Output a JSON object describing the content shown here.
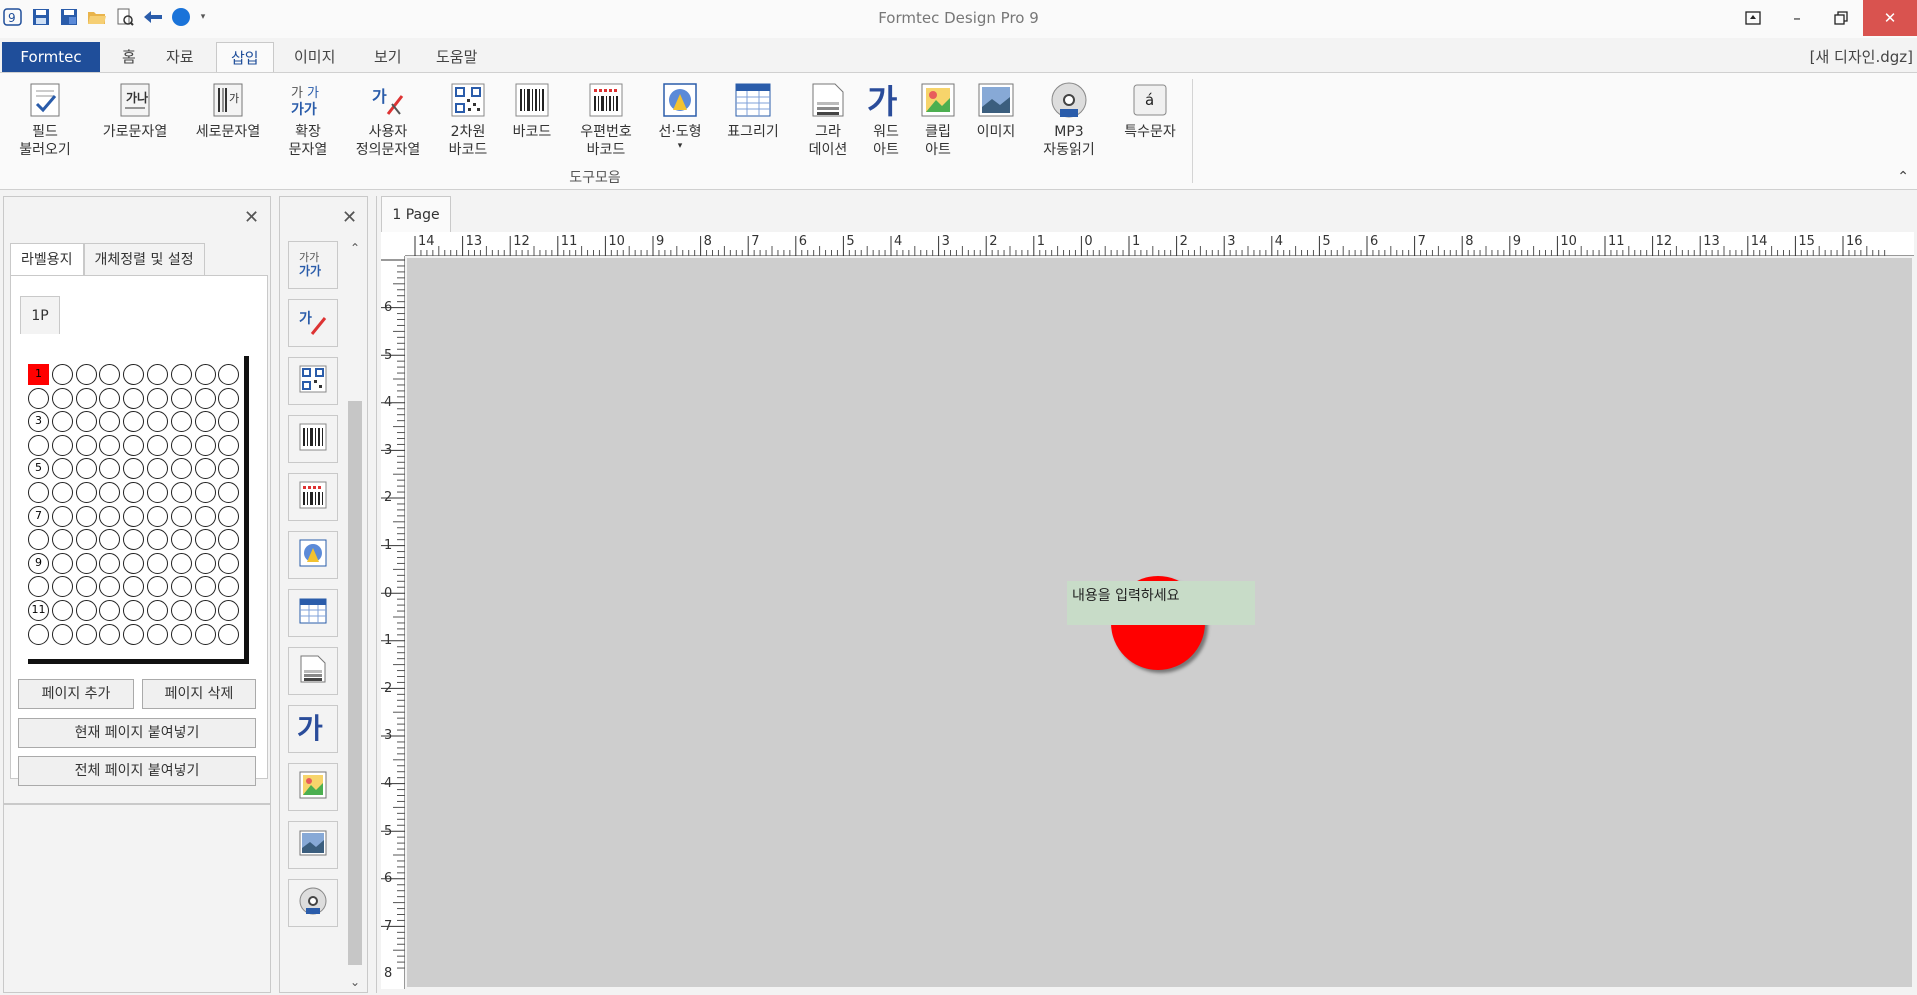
{
  "window": {
    "title": "Formtec Design Pro 9",
    "document": "[새 디자인.dgz]"
  },
  "quick_access": [
    "app-icon",
    "save-icon",
    "save-as-icon",
    "open-folder-icon",
    "print-preview-icon",
    "undo-icon",
    "color-circle-icon",
    "dropdown-icon"
  ],
  "menu": {
    "tabs": [
      "Formtec",
      "홈",
      "자료",
      "삽입",
      "이미지",
      "보기",
      "도움말"
    ],
    "active": "삽입"
  },
  "ribbon": {
    "items": [
      {
        "label": "필드\n불러오기",
        "icon": "field-load-icon"
      },
      {
        "label": "가로문자열",
        "icon": "horizontal-text-icon"
      },
      {
        "label": "세로문자열",
        "icon": "vertical-text-icon"
      },
      {
        "label": "확장\n문자열",
        "icon": "extended-text-icon"
      },
      {
        "label": "사용자\n정의문자열",
        "icon": "custom-text-icon"
      },
      {
        "label": "2차원\n바코드",
        "icon": "qr-code-icon"
      },
      {
        "label": "바코드",
        "icon": "barcode-icon"
      },
      {
        "label": "우편번호\n바코드",
        "icon": "postal-barcode-icon"
      },
      {
        "label": "선·도형",
        "icon": "shape-icon"
      },
      {
        "label": "표그리기",
        "icon": "table-icon"
      },
      {
        "label": "그라\n데이션",
        "icon": "gradation-icon"
      },
      {
        "label": "워드\n아트",
        "icon": "word-art-icon"
      },
      {
        "label": "클립\n아트",
        "icon": "clip-art-icon"
      },
      {
        "label": "이미지",
        "icon": "image-icon"
      },
      {
        "label": "MP3\n자동읽기",
        "icon": "mp3-icon"
      },
      {
        "label": "특수문자",
        "icon": "special-char-icon"
      }
    ],
    "group_label": "도구모음"
  },
  "left_panel": {
    "tabs": [
      "라벨용지",
      "개체정렬 및 설정"
    ],
    "active_tab": "라벨용지",
    "page_tab": "1P",
    "row_labels": [
      "1",
      "3",
      "5",
      "7",
      "9",
      "11"
    ],
    "grid_rows": 12,
    "grid_cols": 9,
    "buttons": {
      "add_page": "페이지 추가",
      "delete_page": "페이지 삭제",
      "paste_current": "현재 페이지 붙여넣기",
      "paste_all": "전체 페이지 붙여넣기"
    }
  },
  "tool_panel": {
    "tools": [
      "extended-text-icon",
      "custom-text-icon",
      "qr-code-icon",
      "barcode-icon",
      "postal-barcode-icon",
      "shape-icon",
      "table-icon",
      "gradation-icon",
      "word-art-icon",
      "clip-art-icon",
      "image-icon",
      "mp3-icon"
    ]
  },
  "canvas": {
    "page_tab": "1 Page",
    "ruler_h": [
      "14",
      "13",
      "12",
      "11",
      "10",
      "9",
      "8",
      "7",
      "6",
      "5",
      "4",
      "3",
      "2",
      "1",
      "0",
      "1",
      "2",
      "3",
      "4",
      "5",
      "6",
      "7",
      "8",
      "9",
      "10",
      "11",
      "12",
      "13",
      "14",
      "15",
      "16"
    ],
    "ruler_v": [
      "6",
      "5",
      "4",
      "3",
      "2",
      "1",
      "0",
      "1",
      "2",
      "3",
      "4",
      "5",
      "6",
      "7",
      "8"
    ],
    "textbox_text": "내용을 입력하세요",
    "shape_color": "#ff0000",
    "textbox_color": "#c8dcc8"
  },
  "colors": {
    "brand": "#1f4e9a",
    "close_button": "#d9534f",
    "canvas_bg": "#cecece"
  }
}
